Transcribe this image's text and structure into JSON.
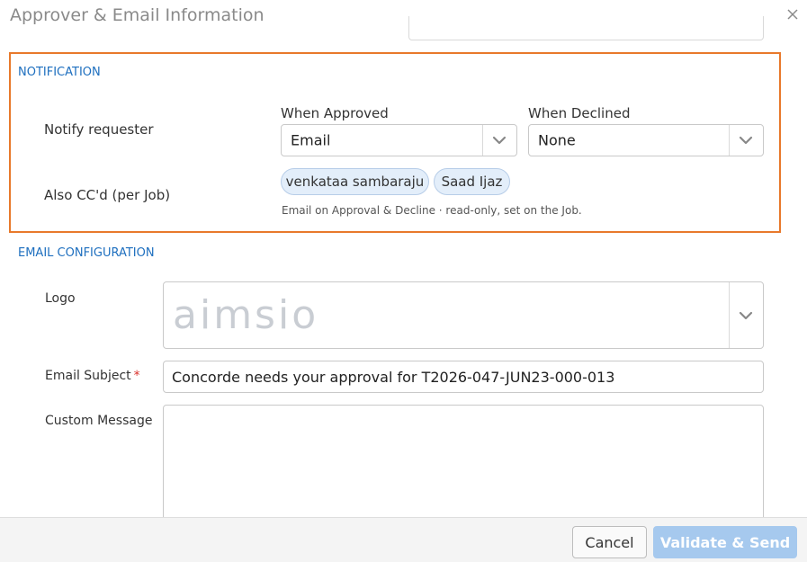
{
  "dialog": {
    "title": "Approver & Email Information"
  },
  "notification": {
    "heading": "NOTIFICATION",
    "notify_requester_label": "Notify requester",
    "when_approved_label": "When Approved",
    "when_approved_value": "Email",
    "when_declined_label": "When Declined",
    "when_declined_value": "None",
    "also_cc_label": "Also CC'd (per Job)",
    "cc_recipients": [
      "venkataa sambaraju",
      "Saad Ijaz"
    ],
    "cc_note": "Email on Approval & Decline · read-only, set on the Job."
  },
  "email_config": {
    "heading": "EMAIL CONFIGURATION",
    "logo_label": "Logo",
    "logo_value": "aimsio",
    "subject_label": "Email Subject",
    "subject_required_mark": "*",
    "subject_value": "Concorde needs your approval for T2026-047-JUN23-000-013",
    "custom_message_label": "Custom Message",
    "custom_message_value": ""
  },
  "footer": {
    "cancel_label": "Cancel",
    "send_label": "Validate & Send"
  },
  "colors": {
    "accent_blue": "#1e6fbf",
    "highlight_orange": "#e8792b",
    "primary_disabled": "#a6c9ee",
    "chip_bg": "#e3eefa",
    "required_red": "#d9312b"
  },
  "icons": {
    "close": "close-icon",
    "dropdown": "chevron-down-icon"
  }
}
